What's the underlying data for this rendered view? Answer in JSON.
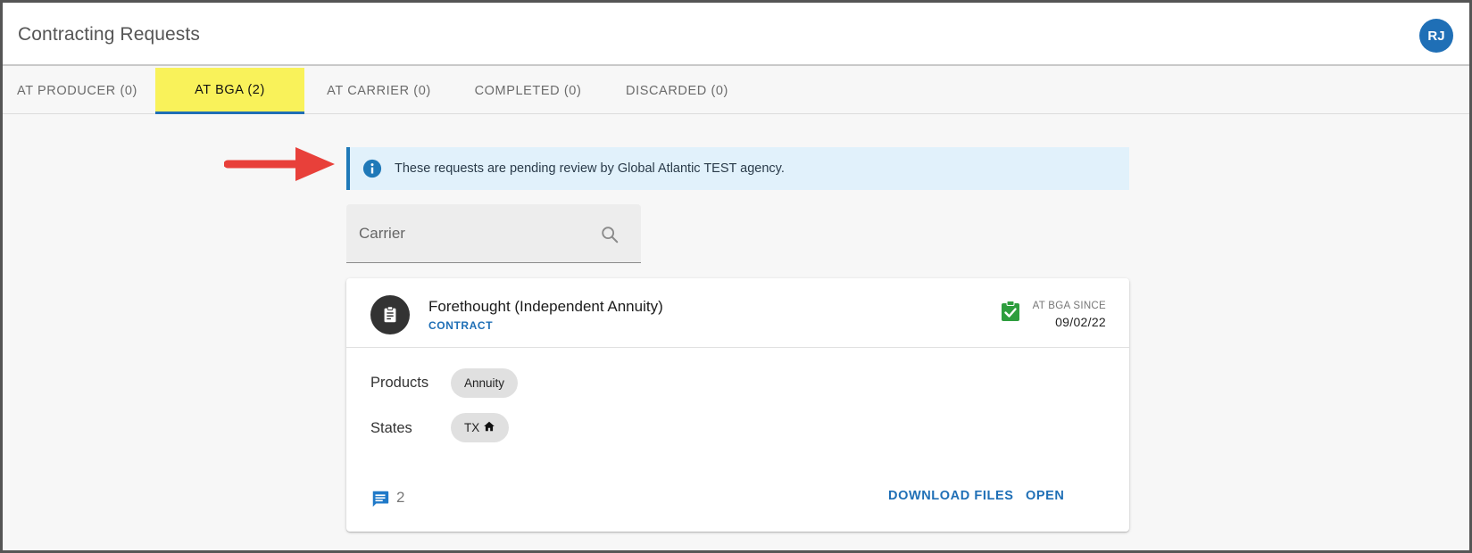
{
  "header": {
    "title": "Contracting Requests",
    "avatar_initials": "RJ"
  },
  "tabs": [
    {
      "label": "AT PRODUCER (0)",
      "active": false
    },
    {
      "label": "AT BGA (2)",
      "active": true
    },
    {
      "label": "AT CARRIER (0)",
      "active": false
    },
    {
      "label": "COMPLETED (0)",
      "active": false
    },
    {
      "label": "DISCARDED (0)",
      "active": false
    }
  ],
  "alert": {
    "text": "These requests are pending review by Global Atlantic TEST agency."
  },
  "search": {
    "placeholder": "Carrier",
    "value": ""
  },
  "card": {
    "title": "Forethought (Independent Annuity)",
    "subtitle": "CONTRACT",
    "status_label": "AT BGA SINCE",
    "status_date": "09/02/22",
    "products_label": "Products",
    "products": [
      "Annuity"
    ],
    "states_label": "States",
    "states": [
      "TX"
    ],
    "comment_count": "2",
    "download_label": "DOWNLOAD FILES",
    "open_label": "OPEN"
  },
  "colors": {
    "accent": "#1f6fb6",
    "active_tab_highlight": "#f9f25a",
    "alert_bg": "#e1f1fb",
    "status_green": "#2e9e3e",
    "arrow_red": "#e8403a"
  },
  "icons": {
    "alert": "info-icon",
    "search": "search-icon",
    "card": "clipboard-icon",
    "status": "clipboard-check-icon",
    "home_state": "home-icon",
    "comments": "comment-icon",
    "annotation": "arrow-right-icon"
  }
}
